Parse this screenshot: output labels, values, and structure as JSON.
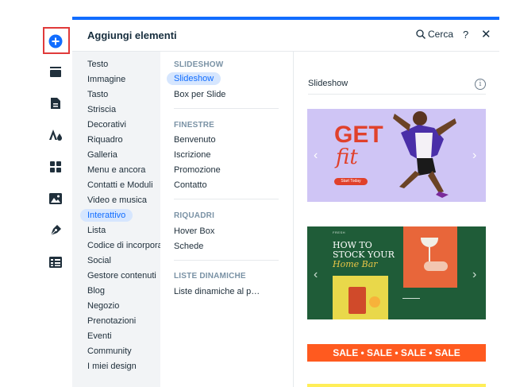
{
  "header": {
    "title": "Aggiungi elementi",
    "search_label": "Cerca",
    "help_label": "?",
    "close_label": "✕"
  },
  "rail": {
    "items": [
      {
        "name": "add-elements-icon"
      },
      {
        "name": "sections-icon"
      },
      {
        "name": "pages-icon"
      },
      {
        "name": "design-icon"
      },
      {
        "name": "apps-icon"
      },
      {
        "name": "media-icon"
      },
      {
        "name": "blog-pen-icon"
      },
      {
        "name": "table-icon"
      }
    ]
  },
  "categories": [
    "Testo",
    "Immagine",
    "Tasto",
    "Striscia",
    "Decorativi",
    "Riquadro",
    "Galleria",
    "Menu e ancora",
    "Contatti e Moduli",
    "Video e musica",
    "Interattivo",
    "Lista",
    "Codice di incorpora…",
    "Social",
    "Gestore contenuti",
    "Blog",
    "Negozio",
    "Prenotazioni",
    "Eventi",
    "Community",
    "I miei design"
  ],
  "selected_category": "Interattivo",
  "subcategories": {
    "slideshow": {
      "heading": "SLIDESHOW",
      "items": [
        "Slideshow",
        "Box per Slide"
      ]
    },
    "finestre": {
      "heading": "FINESTRE",
      "items": [
        "Benvenuto",
        "Iscrizione",
        "Promozione",
        "Contatto"
      ]
    },
    "riquadri": {
      "heading": "RIQUADRI",
      "items": [
        "Hover Box",
        "Schede"
      ]
    },
    "liste": {
      "heading": "LISTE DINAMICHE",
      "items": [
        "Liste dinamiche al p…"
      ]
    }
  },
  "selected_subcategory": "Slideshow",
  "preview": {
    "title": "Slideshow",
    "info_label": "i",
    "card1": {
      "headline1": "GET",
      "headline2": "fit",
      "button": "Start Today",
      "bg": "#cfc5f5",
      "accent": "#e0412b"
    },
    "card2": {
      "line1": "HOW TO",
      "line2": "STOCK YOUR",
      "line3": "Home Bar",
      "kicker": "FRESH",
      "bg": "#1f5c38",
      "accent": "#e8663a"
    },
    "card3": {
      "text": "SALE • SALE • SALE • SALE",
      "bg": "#ff5a1f"
    },
    "card4": {
      "bg": "#ffee58"
    }
  },
  "colors": {
    "brand_blue": "#116dff",
    "highlight": "#d6e6fe",
    "rail_highlight": "#e03a3a"
  }
}
